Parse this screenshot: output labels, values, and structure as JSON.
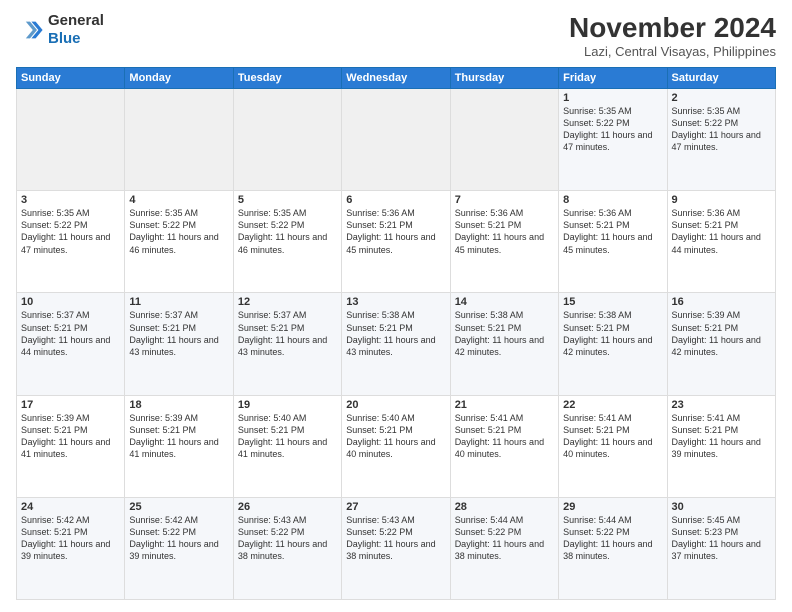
{
  "logo": {
    "line1": "General",
    "line2": "Blue"
  },
  "title": "November 2024",
  "subtitle": "Lazi, Central Visayas, Philippines",
  "days_header": [
    "Sunday",
    "Monday",
    "Tuesday",
    "Wednesday",
    "Thursday",
    "Friday",
    "Saturday"
  ],
  "weeks": [
    [
      {
        "day": "",
        "info": ""
      },
      {
        "day": "",
        "info": ""
      },
      {
        "day": "",
        "info": ""
      },
      {
        "day": "",
        "info": ""
      },
      {
        "day": "",
        "info": ""
      },
      {
        "day": "1",
        "info": "Sunrise: 5:35 AM\nSunset: 5:22 PM\nDaylight: 11 hours\nand 47 minutes."
      },
      {
        "day": "2",
        "info": "Sunrise: 5:35 AM\nSunset: 5:22 PM\nDaylight: 11 hours\nand 47 minutes."
      }
    ],
    [
      {
        "day": "3",
        "info": "Sunrise: 5:35 AM\nSunset: 5:22 PM\nDaylight: 11 hours\nand 47 minutes."
      },
      {
        "day": "4",
        "info": "Sunrise: 5:35 AM\nSunset: 5:22 PM\nDaylight: 11 hours\nand 46 minutes."
      },
      {
        "day": "5",
        "info": "Sunrise: 5:35 AM\nSunset: 5:22 PM\nDaylight: 11 hours\nand 46 minutes."
      },
      {
        "day": "6",
        "info": "Sunrise: 5:36 AM\nSunset: 5:21 PM\nDaylight: 11 hours\nand 45 minutes."
      },
      {
        "day": "7",
        "info": "Sunrise: 5:36 AM\nSunset: 5:21 PM\nDaylight: 11 hours\nand 45 minutes."
      },
      {
        "day": "8",
        "info": "Sunrise: 5:36 AM\nSunset: 5:21 PM\nDaylight: 11 hours\nand 45 minutes."
      },
      {
        "day": "9",
        "info": "Sunrise: 5:36 AM\nSunset: 5:21 PM\nDaylight: 11 hours\nand 44 minutes."
      }
    ],
    [
      {
        "day": "10",
        "info": "Sunrise: 5:37 AM\nSunset: 5:21 PM\nDaylight: 11 hours\nand 44 minutes."
      },
      {
        "day": "11",
        "info": "Sunrise: 5:37 AM\nSunset: 5:21 PM\nDaylight: 11 hours\nand 43 minutes."
      },
      {
        "day": "12",
        "info": "Sunrise: 5:37 AM\nSunset: 5:21 PM\nDaylight: 11 hours\nand 43 minutes."
      },
      {
        "day": "13",
        "info": "Sunrise: 5:38 AM\nSunset: 5:21 PM\nDaylight: 11 hours\nand 43 minutes."
      },
      {
        "day": "14",
        "info": "Sunrise: 5:38 AM\nSunset: 5:21 PM\nDaylight: 11 hours\nand 42 minutes."
      },
      {
        "day": "15",
        "info": "Sunrise: 5:38 AM\nSunset: 5:21 PM\nDaylight: 11 hours\nand 42 minutes."
      },
      {
        "day": "16",
        "info": "Sunrise: 5:39 AM\nSunset: 5:21 PM\nDaylight: 11 hours\nand 42 minutes."
      }
    ],
    [
      {
        "day": "17",
        "info": "Sunrise: 5:39 AM\nSunset: 5:21 PM\nDaylight: 11 hours\nand 41 minutes."
      },
      {
        "day": "18",
        "info": "Sunrise: 5:39 AM\nSunset: 5:21 PM\nDaylight: 11 hours\nand 41 minutes."
      },
      {
        "day": "19",
        "info": "Sunrise: 5:40 AM\nSunset: 5:21 PM\nDaylight: 11 hours\nand 41 minutes."
      },
      {
        "day": "20",
        "info": "Sunrise: 5:40 AM\nSunset: 5:21 PM\nDaylight: 11 hours\nand 40 minutes."
      },
      {
        "day": "21",
        "info": "Sunrise: 5:41 AM\nSunset: 5:21 PM\nDaylight: 11 hours\nand 40 minutes."
      },
      {
        "day": "22",
        "info": "Sunrise: 5:41 AM\nSunset: 5:21 PM\nDaylight: 11 hours\nand 40 minutes."
      },
      {
        "day": "23",
        "info": "Sunrise: 5:41 AM\nSunset: 5:21 PM\nDaylight: 11 hours\nand 39 minutes."
      }
    ],
    [
      {
        "day": "24",
        "info": "Sunrise: 5:42 AM\nSunset: 5:21 PM\nDaylight: 11 hours\nand 39 minutes."
      },
      {
        "day": "25",
        "info": "Sunrise: 5:42 AM\nSunset: 5:22 PM\nDaylight: 11 hours\nand 39 minutes."
      },
      {
        "day": "26",
        "info": "Sunrise: 5:43 AM\nSunset: 5:22 PM\nDaylight: 11 hours\nand 38 minutes."
      },
      {
        "day": "27",
        "info": "Sunrise: 5:43 AM\nSunset: 5:22 PM\nDaylight: 11 hours\nand 38 minutes."
      },
      {
        "day": "28",
        "info": "Sunrise: 5:44 AM\nSunset: 5:22 PM\nDaylight: 11 hours\nand 38 minutes."
      },
      {
        "day": "29",
        "info": "Sunrise: 5:44 AM\nSunset: 5:22 PM\nDaylight: 11 hours\nand 38 minutes."
      },
      {
        "day": "30",
        "info": "Sunrise: 5:45 AM\nSunset: 5:23 PM\nDaylight: 11 hours\nand 37 minutes."
      }
    ]
  ]
}
